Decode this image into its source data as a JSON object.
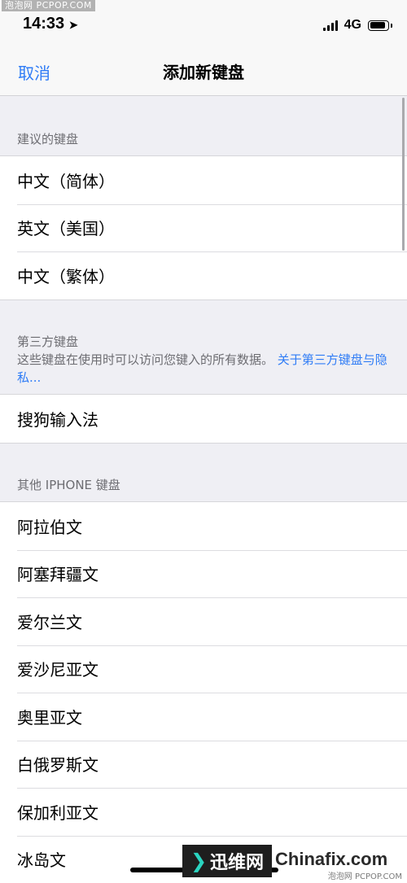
{
  "watermark_top": "泡泡网 PCPOP.COM",
  "status_bar": {
    "time": "14:33",
    "network": "4G"
  },
  "nav": {
    "cancel": "取消",
    "title": "添加新键盘"
  },
  "suggested": {
    "header": "建议的键盘",
    "items": [
      "中文（简体）",
      "英文（美国）",
      "中文（繁体）"
    ]
  },
  "third_party": {
    "header": "第三方键盘",
    "description": "这些键盘在使用时可以访问您键入的所有数据。",
    "link": "关于第三方键盘与隐私...",
    "items": [
      "搜狗输入法"
    ]
  },
  "other": {
    "header": "其他 IPHONE 键盘",
    "items": [
      "阿拉伯文",
      "阿塞拜疆文",
      "爱尔兰文",
      "爱沙尼亚文",
      "奥里亚文",
      "白俄罗斯文",
      "保加利亚文",
      "冰岛文"
    ]
  },
  "watermark_bottom": {
    "badge": "迅维网",
    "brand": "Chinafix.com",
    "small": "泡泡网 PCPOP.COM"
  }
}
